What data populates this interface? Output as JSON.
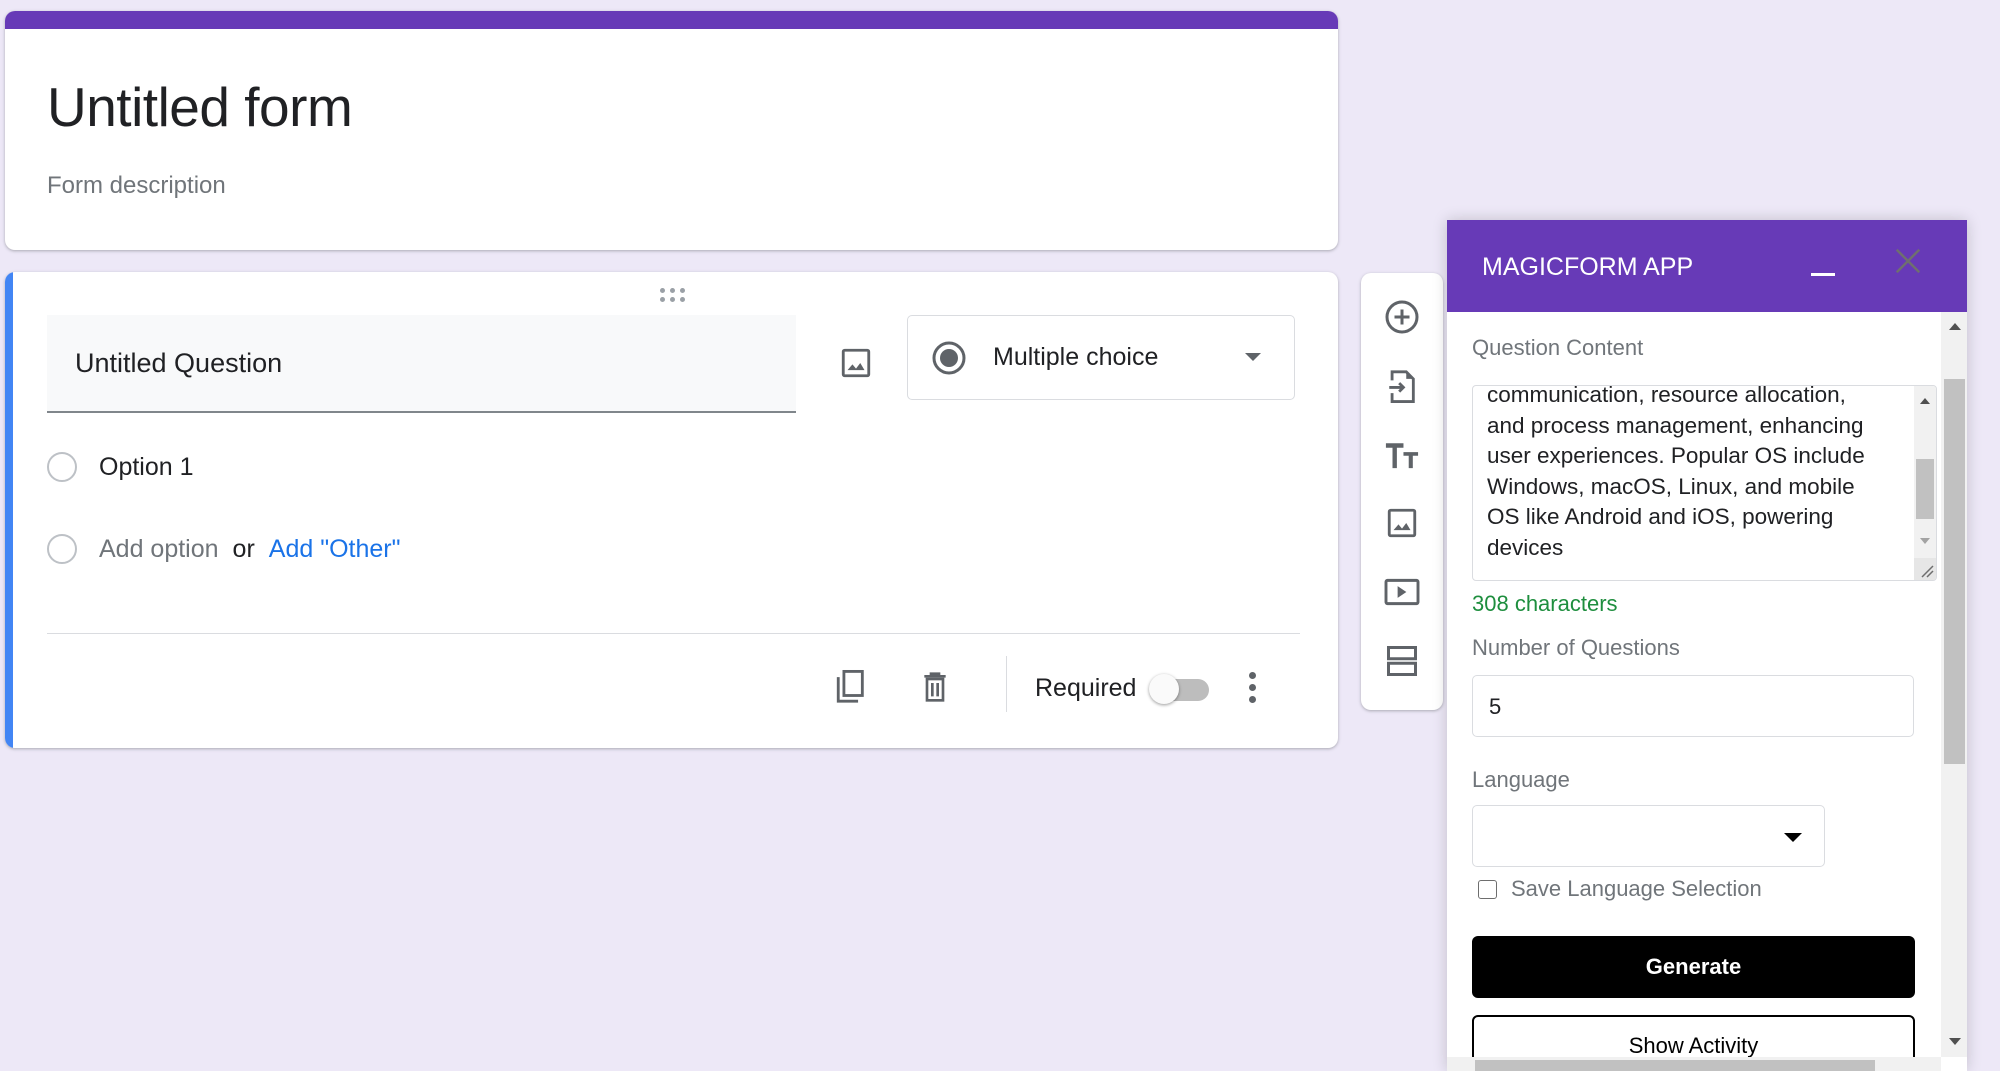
{
  "form": {
    "title": "Untitled form",
    "description_placeholder": "Form description",
    "theme_color": "#673ab7"
  },
  "question": {
    "title": "Untitled Question",
    "type": "Multiple choice",
    "options": [
      "Option 1"
    ],
    "add_option_label": "Add option",
    "or_label": "or",
    "add_other_label": "Add \"Other\"",
    "required_label": "Required",
    "required": false,
    "accent_color": "#4285f4"
  },
  "side_toolbar": {
    "items": [
      {
        "icon": "add-circle-icon",
        "label": "Add question"
      },
      {
        "icon": "import-icon",
        "label": "Import questions"
      },
      {
        "icon": "title-icon",
        "label": "Add title and description"
      },
      {
        "icon": "image-icon",
        "label": "Add image"
      },
      {
        "icon": "video-icon",
        "label": "Add video"
      },
      {
        "icon": "section-icon",
        "label": "Add section"
      }
    ]
  },
  "magic_panel": {
    "title": "MAGICFORM APP",
    "question_content_label": "Question Content",
    "question_content_value": "communication, resource allocation,\nand process management, enhancing\nuser experiences. Popular OS include\nWindows, macOS, Linux, and mobile\nOS like Android and iOS, powering\ndevices",
    "char_count": "308 characters",
    "num_questions_label": "Number of Questions",
    "num_questions_value": "5",
    "language_label": "Language",
    "language_value": "",
    "save_language_label": "Save Language Selection",
    "save_language_checked": false,
    "generate_label": "Generate",
    "show_activity_label": "Show Activity",
    "char_count_color": "#1e8e3e"
  }
}
